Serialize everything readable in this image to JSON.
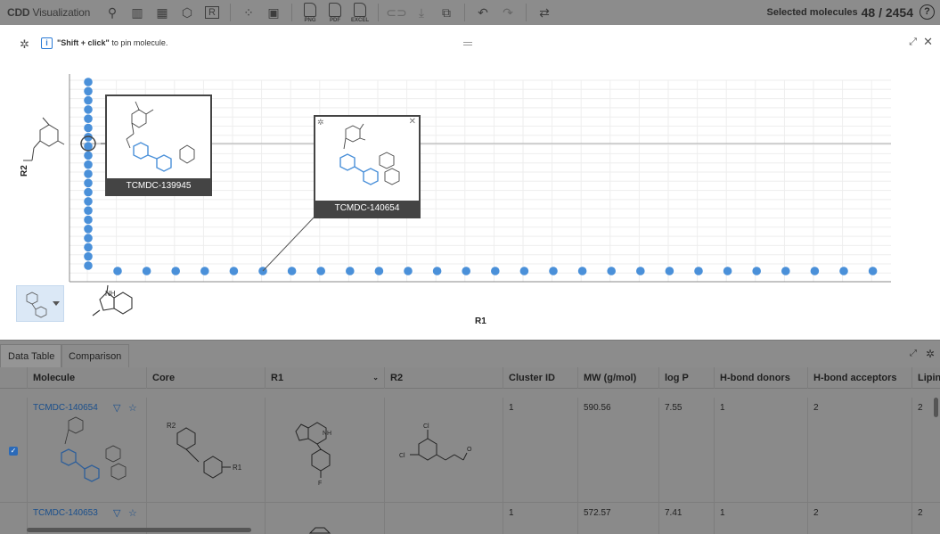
{
  "toolbar": {
    "brand_bold": "CDD",
    "brand_rest": " Visualization",
    "r_label": "R",
    "exports": [
      "PNG",
      "PDF",
      "EXCEL"
    ],
    "selected_label": "Selected molecules",
    "selected_count": "48 / 2454",
    "help": "?"
  },
  "plot": {
    "hint_bold": "\"Shift + click\"",
    "hint_rest": " to pin molecule.",
    "x_label": "R1",
    "y_label": "R2",
    "popups": [
      {
        "caption": "TCMDC-139945"
      },
      {
        "caption": "TCMDC-140654"
      }
    ]
  },
  "bottom": {
    "tabs": [
      "Data Table",
      "Comparison"
    ],
    "columns": [
      "Molecule",
      "Core",
      "R1",
      "R2",
      "Cluster ID",
      "MW (g/mol)",
      "log P",
      "H-bond donors",
      "H-bond acceptors",
      "Lipin"
    ],
    "rows": [
      {
        "id": "TCMDC-140654",
        "cluster": "1",
        "mw": "590.56",
        "logp": "7.55",
        "donors": "1",
        "acceptors": "2",
        "lipinski": "2"
      },
      {
        "id": "TCMDC-140653",
        "cluster": "1",
        "mw": "572.57",
        "logp": "7.41",
        "donors": "1",
        "acceptors": "2",
        "lipinski": "2"
      }
    ]
  },
  "colors": {
    "accent": "#4a90d9",
    "dim": "#8a8a8a"
  }
}
